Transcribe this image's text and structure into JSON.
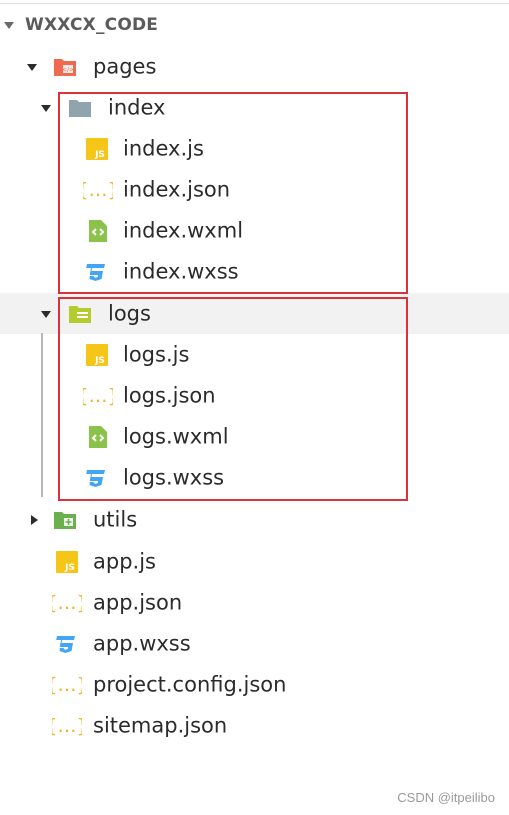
{
  "explorer": {
    "section_title": "WXXCX_CODE",
    "items": [
      {
        "label": "pages",
        "type": "folder-pages"
      },
      {
        "label": "index",
        "type": "folder"
      },
      {
        "label": "index.js",
        "type": "js"
      },
      {
        "label": "index.json",
        "type": "json"
      },
      {
        "label": "index.wxml",
        "type": "wxml"
      },
      {
        "label": "index.wxss",
        "type": "wxss"
      },
      {
        "label": "logs",
        "type": "folder"
      },
      {
        "label": "logs.js",
        "type": "js"
      },
      {
        "label": "logs.json",
        "type": "json"
      },
      {
        "label": "logs.wxml",
        "type": "wxml"
      },
      {
        "label": "logs.wxss",
        "type": "wxss"
      },
      {
        "label": "utils",
        "type": "folder-utils"
      },
      {
        "label": "app.js",
        "type": "js"
      },
      {
        "label": "app.json",
        "type": "json"
      },
      {
        "label": "app.wxss",
        "type": "wxss"
      },
      {
        "label": "project.config.json",
        "type": "json"
      },
      {
        "label": "sitemap.json",
        "type": "json"
      }
    ]
  },
  "watermark": "CSDN @itpeilibo",
  "colors": {
    "highlight_box": "#d6333c",
    "js_icon": "#f5c518",
    "json_icon": "#f0b429",
    "wxml_icon": "#8bc34a",
    "wxss_icon": "#42a5f5",
    "pages_folder": "#ef6a4f",
    "index_folder": "#90a4ae",
    "logs_folder": "#b5cc2e",
    "utils_folder": "#6ab04c"
  }
}
